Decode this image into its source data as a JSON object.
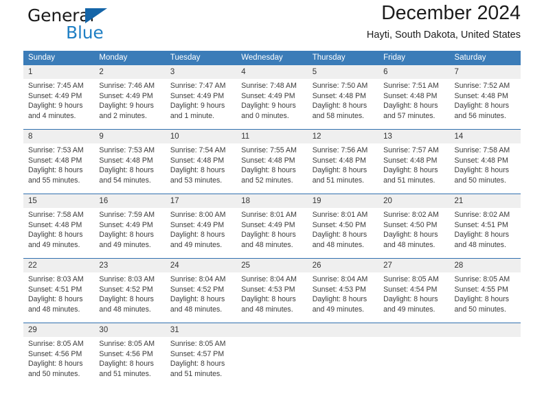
{
  "brand": {
    "name_part1": "General",
    "name_part2": "Blue",
    "triangle_color": "#1565a8",
    "blue_color": "#1f7fc4"
  },
  "header": {
    "title": "December 2024",
    "subtitle": "Hayti, South Dakota, United States"
  },
  "theme": {
    "header_bg": "#3b7cb8",
    "row_divider": "#2f6fae",
    "daynum_bg": "#efefef",
    "cell_bg": "#ffffff"
  },
  "weekdays": [
    "Sunday",
    "Monday",
    "Tuesday",
    "Wednesday",
    "Thursday",
    "Friday",
    "Saturday"
  ],
  "weeks": [
    [
      {
        "day": "1",
        "sunrise": "Sunrise: 7:45 AM",
        "sunset": "Sunset: 4:49 PM",
        "daylight1": "Daylight: 9 hours",
        "daylight2": "and 4 minutes."
      },
      {
        "day": "2",
        "sunrise": "Sunrise: 7:46 AM",
        "sunset": "Sunset: 4:49 PM",
        "daylight1": "Daylight: 9 hours",
        "daylight2": "and 2 minutes."
      },
      {
        "day": "3",
        "sunrise": "Sunrise: 7:47 AM",
        "sunset": "Sunset: 4:49 PM",
        "daylight1": "Daylight: 9 hours",
        "daylight2": "and 1 minute."
      },
      {
        "day": "4",
        "sunrise": "Sunrise: 7:48 AM",
        "sunset": "Sunset: 4:49 PM",
        "daylight1": "Daylight: 9 hours",
        "daylight2": "and 0 minutes."
      },
      {
        "day": "5",
        "sunrise": "Sunrise: 7:50 AM",
        "sunset": "Sunset: 4:48 PM",
        "daylight1": "Daylight: 8 hours",
        "daylight2": "and 58 minutes."
      },
      {
        "day": "6",
        "sunrise": "Sunrise: 7:51 AM",
        "sunset": "Sunset: 4:48 PM",
        "daylight1": "Daylight: 8 hours",
        "daylight2": "and 57 minutes."
      },
      {
        "day": "7",
        "sunrise": "Sunrise: 7:52 AM",
        "sunset": "Sunset: 4:48 PM",
        "daylight1": "Daylight: 8 hours",
        "daylight2": "and 56 minutes."
      }
    ],
    [
      {
        "day": "8",
        "sunrise": "Sunrise: 7:53 AM",
        "sunset": "Sunset: 4:48 PM",
        "daylight1": "Daylight: 8 hours",
        "daylight2": "and 55 minutes."
      },
      {
        "day": "9",
        "sunrise": "Sunrise: 7:53 AM",
        "sunset": "Sunset: 4:48 PM",
        "daylight1": "Daylight: 8 hours",
        "daylight2": "and 54 minutes."
      },
      {
        "day": "10",
        "sunrise": "Sunrise: 7:54 AM",
        "sunset": "Sunset: 4:48 PM",
        "daylight1": "Daylight: 8 hours",
        "daylight2": "and 53 minutes."
      },
      {
        "day": "11",
        "sunrise": "Sunrise: 7:55 AM",
        "sunset": "Sunset: 4:48 PM",
        "daylight1": "Daylight: 8 hours",
        "daylight2": "and 52 minutes."
      },
      {
        "day": "12",
        "sunrise": "Sunrise: 7:56 AM",
        "sunset": "Sunset: 4:48 PM",
        "daylight1": "Daylight: 8 hours",
        "daylight2": "and 51 minutes."
      },
      {
        "day": "13",
        "sunrise": "Sunrise: 7:57 AM",
        "sunset": "Sunset: 4:48 PM",
        "daylight1": "Daylight: 8 hours",
        "daylight2": "and 51 minutes."
      },
      {
        "day": "14",
        "sunrise": "Sunrise: 7:58 AM",
        "sunset": "Sunset: 4:48 PM",
        "daylight1": "Daylight: 8 hours",
        "daylight2": "and 50 minutes."
      }
    ],
    [
      {
        "day": "15",
        "sunrise": "Sunrise: 7:58 AM",
        "sunset": "Sunset: 4:48 PM",
        "daylight1": "Daylight: 8 hours",
        "daylight2": "and 49 minutes."
      },
      {
        "day": "16",
        "sunrise": "Sunrise: 7:59 AM",
        "sunset": "Sunset: 4:49 PM",
        "daylight1": "Daylight: 8 hours",
        "daylight2": "and 49 minutes."
      },
      {
        "day": "17",
        "sunrise": "Sunrise: 8:00 AM",
        "sunset": "Sunset: 4:49 PM",
        "daylight1": "Daylight: 8 hours",
        "daylight2": "and 49 minutes."
      },
      {
        "day": "18",
        "sunrise": "Sunrise: 8:01 AM",
        "sunset": "Sunset: 4:49 PM",
        "daylight1": "Daylight: 8 hours",
        "daylight2": "and 48 minutes."
      },
      {
        "day": "19",
        "sunrise": "Sunrise: 8:01 AM",
        "sunset": "Sunset: 4:50 PM",
        "daylight1": "Daylight: 8 hours",
        "daylight2": "and 48 minutes."
      },
      {
        "day": "20",
        "sunrise": "Sunrise: 8:02 AM",
        "sunset": "Sunset: 4:50 PM",
        "daylight1": "Daylight: 8 hours",
        "daylight2": "and 48 minutes."
      },
      {
        "day": "21",
        "sunrise": "Sunrise: 8:02 AM",
        "sunset": "Sunset: 4:51 PM",
        "daylight1": "Daylight: 8 hours",
        "daylight2": "and 48 minutes."
      }
    ],
    [
      {
        "day": "22",
        "sunrise": "Sunrise: 8:03 AM",
        "sunset": "Sunset: 4:51 PM",
        "daylight1": "Daylight: 8 hours",
        "daylight2": "and 48 minutes."
      },
      {
        "day": "23",
        "sunrise": "Sunrise: 8:03 AM",
        "sunset": "Sunset: 4:52 PM",
        "daylight1": "Daylight: 8 hours",
        "daylight2": "and 48 minutes."
      },
      {
        "day": "24",
        "sunrise": "Sunrise: 8:04 AM",
        "sunset": "Sunset: 4:52 PM",
        "daylight1": "Daylight: 8 hours",
        "daylight2": "and 48 minutes."
      },
      {
        "day": "25",
        "sunrise": "Sunrise: 8:04 AM",
        "sunset": "Sunset: 4:53 PM",
        "daylight1": "Daylight: 8 hours",
        "daylight2": "and 48 minutes."
      },
      {
        "day": "26",
        "sunrise": "Sunrise: 8:04 AM",
        "sunset": "Sunset: 4:53 PM",
        "daylight1": "Daylight: 8 hours",
        "daylight2": "and 49 minutes."
      },
      {
        "day": "27",
        "sunrise": "Sunrise: 8:05 AM",
        "sunset": "Sunset: 4:54 PM",
        "daylight1": "Daylight: 8 hours",
        "daylight2": "and 49 minutes."
      },
      {
        "day": "28",
        "sunrise": "Sunrise: 8:05 AM",
        "sunset": "Sunset: 4:55 PM",
        "daylight1": "Daylight: 8 hours",
        "daylight2": "and 50 minutes."
      }
    ],
    [
      {
        "day": "29",
        "sunrise": "Sunrise: 8:05 AM",
        "sunset": "Sunset: 4:56 PM",
        "daylight1": "Daylight: 8 hours",
        "daylight2": "and 50 minutes."
      },
      {
        "day": "30",
        "sunrise": "Sunrise: 8:05 AM",
        "sunset": "Sunset: 4:56 PM",
        "daylight1": "Daylight: 8 hours",
        "daylight2": "and 51 minutes."
      },
      {
        "day": "31",
        "sunrise": "Sunrise: 8:05 AM",
        "sunset": "Sunset: 4:57 PM",
        "daylight1": "Daylight: 8 hours",
        "daylight2": "and 51 minutes."
      },
      {
        "day": "",
        "sunrise": "",
        "sunset": "",
        "daylight1": "",
        "daylight2": ""
      },
      {
        "day": "",
        "sunrise": "",
        "sunset": "",
        "daylight1": "",
        "daylight2": ""
      },
      {
        "day": "",
        "sunrise": "",
        "sunset": "",
        "daylight1": "",
        "daylight2": ""
      },
      {
        "day": "",
        "sunrise": "",
        "sunset": "",
        "daylight1": "",
        "daylight2": ""
      }
    ]
  ]
}
